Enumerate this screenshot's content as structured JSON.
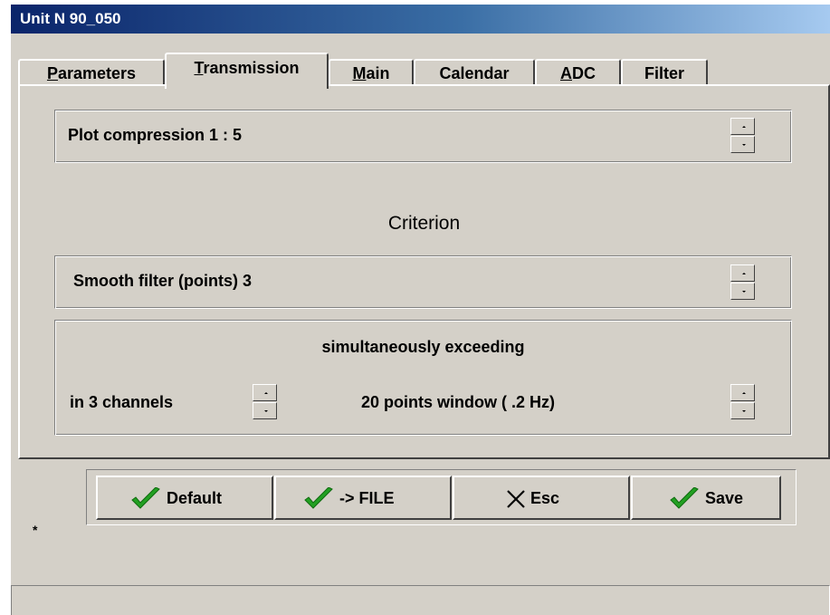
{
  "window": {
    "title": "Unit  N 90_050"
  },
  "tabs": [
    {
      "label": "Parameters",
      "mnemonic": "P"
    },
    {
      "label": "Transmission",
      "mnemonic": "T",
      "active": true
    },
    {
      "label": "Main",
      "mnemonic": "M"
    },
    {
      "label": "Calendar",
      "mnemonic": ""
    },
    {
      "label": "ADC",
      "mnemonic": "A"
    },
    {
      "label": "Filter",
      "mnemonic": ""
    }
  ],
  "transmission": {
    "plot_compression": "Plot compression  1 : 5",
    "criterion_heading": "Criterion",
    "smooth_filter": "Smooth filter (points) 3",
    "exceeding_heading": "simultaneously exceeding",
    "channels": "in  3  channels",
    "window": "20 points window ( .2 Hz)"
  },
  "buttons": {
    "default": "Default",
    "file": "-> FILE",
    "esc": "Esc",
    "save": "Save"
  },
  "marker": "*",
  "status": {
    "text": ""
  },
  "colors": {
    "face": "#d4d0c8",
    "titlebar": "#0a246a",
    "check": "#22a022"
  },
  "icons": {
    "check": "check-icon",
    "cross": "cross-icon"
  }
}
